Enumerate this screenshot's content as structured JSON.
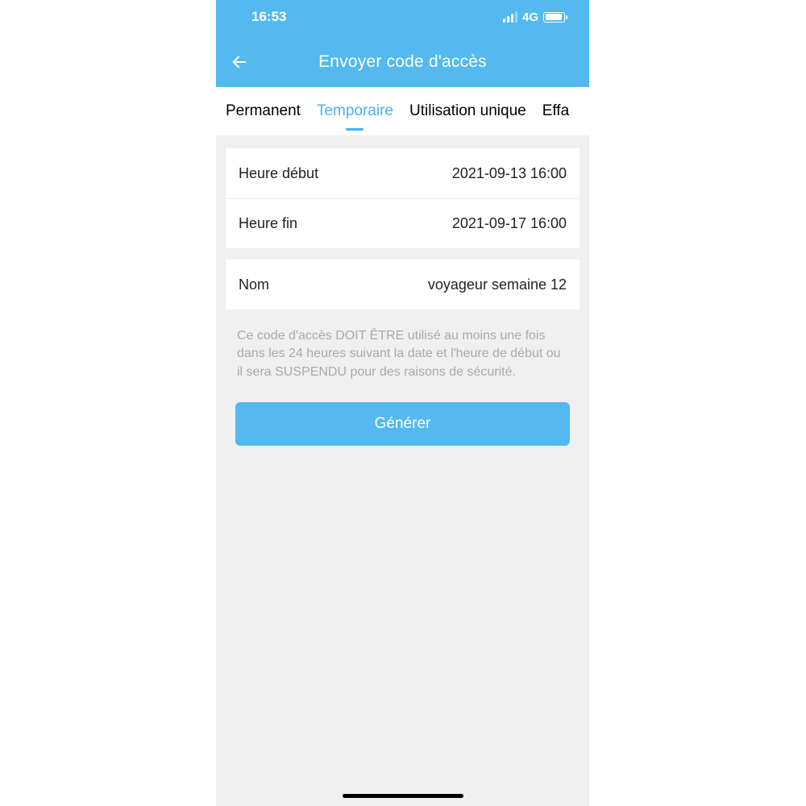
{
  "statusbar": {
    "time": "16:53",
    "network": "4G"
  },
  "navbar": {
    "title": "Envoyer code d'accès"
  },
  "tabs": {
    "items": [
      {
        "label": "Permanent"
      },
      {
        "label": "Temporaire"
      },
      {
        "label": "Utilisation unique"
      },
      {
        "label": "Effa"
      }
    ],
    "activeIndex": 1
  },
  "form": {
    "start": {
      "label": "Heure début",
      "value": "2021-09-13 16:00"
    },
    "end": {
      "label": "Heure fin",
      "value": "2021-09-17 16:00"
    },
    "name": {
      "label": "Nom",
      "value": "voyageur semaine 12"
    }
  },
  "note": "Ce code d'accès DOIT ÊTRE utilisé au moins une fois dans les 24 heures suivant la date et l'heure de début ou il sera SUSPENDU pour des raisons de sécurité.",
  "generate": {
    "label": "Générer"
  }
}
